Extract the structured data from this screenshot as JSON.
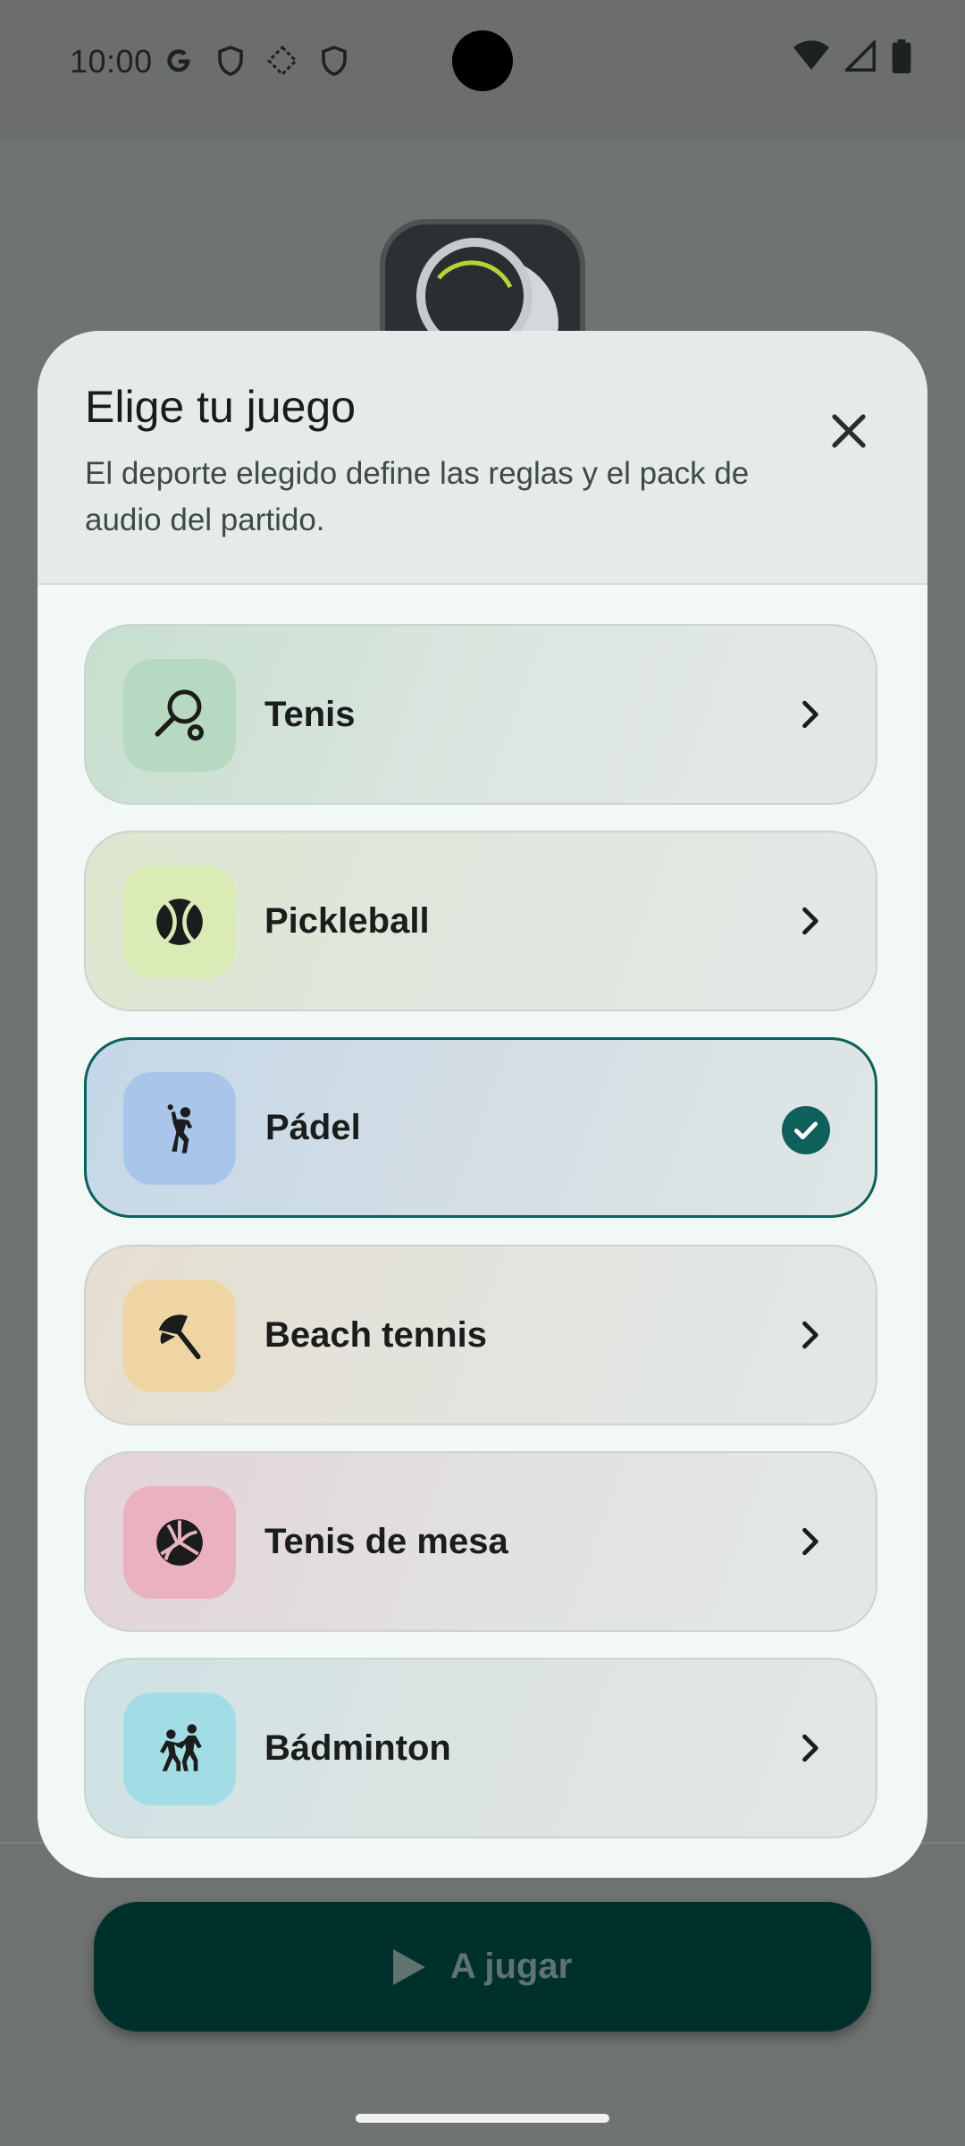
{
  "status_bar": {
    "time": "10:00"
  },
  "sheet": {
    "title": "Elige tu juego",
    "subtitle": "El deporte elegido define las reglas y el pack de audio del partido."
  },
  "sports": [
    {
      "label": "Tenis",
      "icon": "tennis-racket-icon",
      "state": "chevron",
      "tile_color": "#b7d9c1"
    },
    {
      "label": "Pickleball",
      "icon": "tennis-ball-icon",
      "state": "chevron",
      "tile_color": "#dbebb5"
    },
    {
      "label": "Pádel",
      "icon": "padel-player-icon",
      "state": "selected",
      "tile_color": "#a9c6ea"
    },
    {
      "label": "Beach tennis",
      "icon": "beach-umbrella-icon",
      "state": "chevron",
      "tile_color": "#f0d5a4"
    },
    {
      "label": "Tenis de mesa",
      "icon": "volleyball-icon",
      "state": "chevron",
      "tile_color": "#eab2bf"
    },
    {
      "label": "Bádminton",
      "icon": "players-icon",
      "state": "chevron",
      "tile_color": "#a2dde6"
    }
  ],
  "play_button": {
    "label": "A jugar"
  },
  "colors": {
    "accent": "#0f5f5a",
    "scrim": "#6f7473",
    "sheet": "#f2f8f6"
  }
}
